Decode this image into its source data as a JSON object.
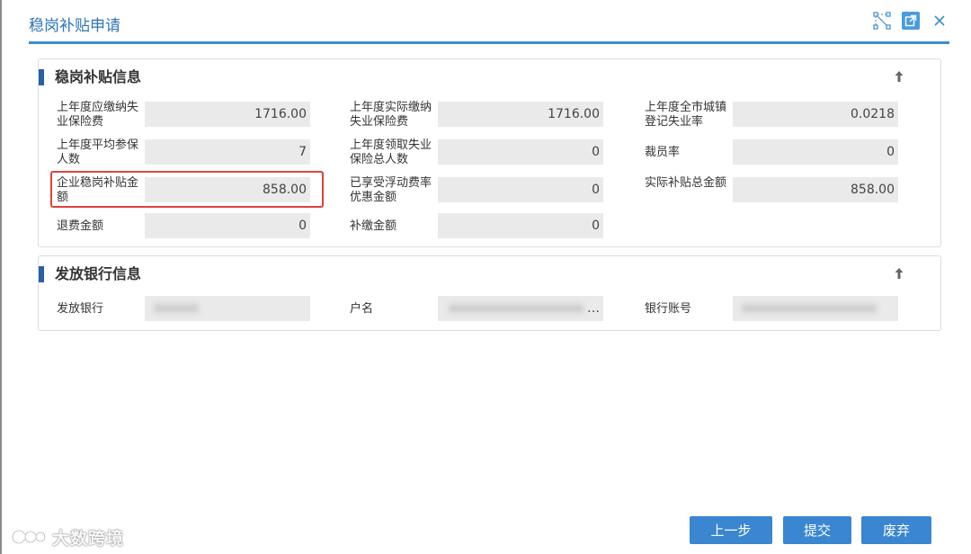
{
  "dialog": {
    "title": "稳岗补贴申请"
  },
  "panel1": {
    "title": "稳岗补贴信息",
    "fields": [
      {
        "label": "上年度应缴纳失业保险费",
        "value": "1716.00"
      },
      {
        "label": "上年度实际缴纳失业保险费",
        "value": "1716.00"
      },
      {
        "label": "上年度全市城镇登记失业率",
        "value": "0.0218"
      },
      {
        "label": "上年度平均参保人数",
        "value": "7"
      },
      {
        "label": "上年度领取失业保险总人数",
        "value": "0"
      },
      {
        "label": "裁员率",
        "value": "0"
      },
      {
        "label": "企业稳岗补贴金额",
        "value": "858.00"
      },
      {
        "label": "已享受浮动费率优惠金额",
        "value": "0"
      },
      {
        "label": "实际补贴总金额",
        "value": "858.00"
      },
      {
        "label": "退费金额",
        "value": "0"
      },
      {
        "label": "补缴金额",
        "value": "0"
      }
    ]
  },
  "panel2": {
    "title": "发放银行信息",
    "fields": [
      {
        "label": "发放银行",
        "value": ""
      },
      {
        "label": "户名",
        "value": "…"
      },
      {
        "label": "银行账号",
        "value": ""
      }
    ]
  },
  "buttons": {
    "prev": "上一步",
    "submit": "提交",
    "discard": "废弃"
  },
  "watermark": {
    "text": "大数跨境"
  },
  "icons": {
    "resize": "resize-icon",
    "popout": "popout-icon",
    "close": "close-icon",
    "collapse": "arrow-up-icon"
  },
  "colors": {
    "accent": "#2a5fa8",
    "title": "#2e75b6",
    "button": "#3a86d0",
    "highlight": "#e0423a"
  }
}
